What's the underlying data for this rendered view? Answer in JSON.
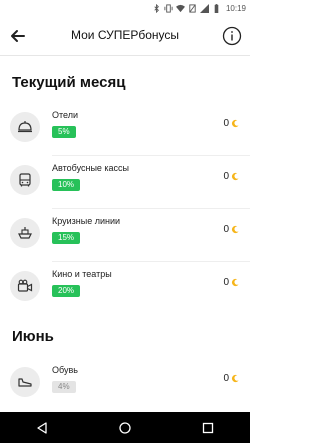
{
  "status_bar": {
    "time": "10:19",
    "icons": [
      "bluetooth-icon",
      "vibrate-icon",
      "wifi-icon",
      "no-sim-icon",
      "signal-icon",
      "battery-icon"
    ]
  },
  "app_bar": {
    "title": "Мои СУПЕРбонусы",
    "back_icon": "arrow-left-icon",
    "info_icon": "info-icon"
  },
  "sections": [
    {
      "title": "Текущий месяц",
      "items": [
        {
          "label": "Отели",
          "badge": "5%",
          "points": "0",
          "icon": "hotel-bell-icon"
        },
        {
          "label": "Автобусные кассы",
          "badge": "10%",
          "points": "0",
          "icon": "bus-icon"
        },
        {
          "label": "Круизные линии",
          "badge": "15%",
          "points": "0",
          "icon": "ship-icon"
        },
        {
          "label": "Кино и театры",
          "badge": "20%",
          "points": "0",
          "icon": "camera-icon"
        }
      ]
    },
    {
      "title": "Июнь",
      "items": [
        {
          "label": "Обувь",
          "badge": "4%",
          "points": "0",
          "icon": "shoe-icon"
        }
      ]
    }
  ],
  "colors": {
    "badge_active": "#27c159",
    "badge_inactive": "#e4e4e4",
    "coin": "#f6b51a",
    "icon_circle": "#ececec"
  },
  "nav_bar": {
    "icons": [
      "nav-back-icon",
      "nav-home-icon",
      "nav-recents-icon"
    ]
  }
}
